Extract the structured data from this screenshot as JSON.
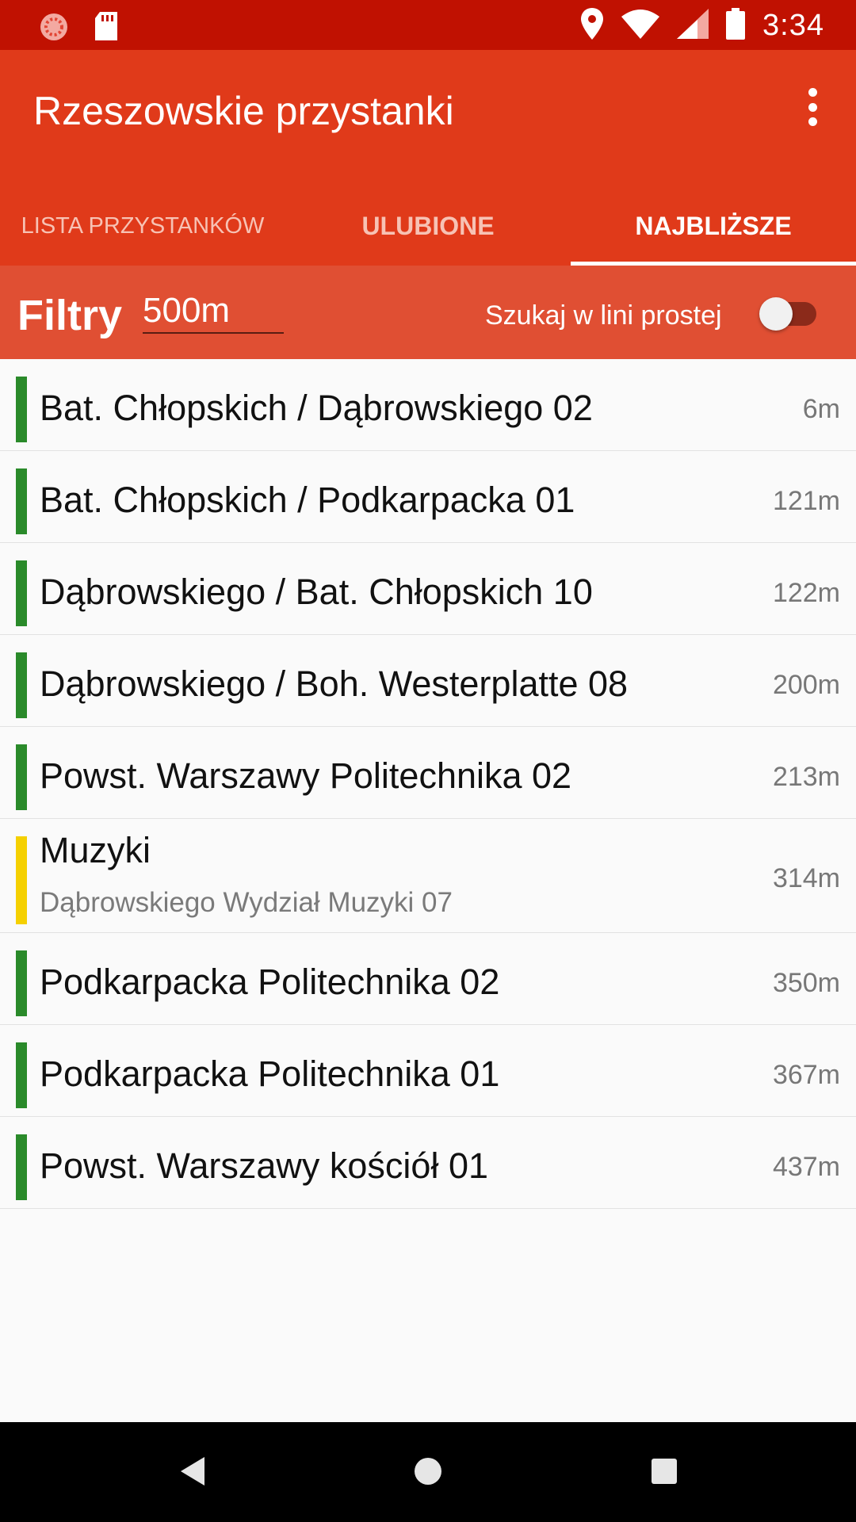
{
  "status_bar": {
    "time": "3:34",
    "icons_left": [
      "circle-notification-icon",
      "sd-card-icon"
    ],
    "icons_right": [
      "location-icon",
      "wifi-icon",
      "signal-icon",
      "battery-icon"
    ]
  },
  "app": {
    "title": "Rzeszowskie przystanki",
    "colors": {
      "status_bar": "#c01101",
      "app_bar": "#e03a1a",
      "filter_bar": "#e04f33"
    }
  },
  "tabs": [
    {
      "label": "LISTA PRZYSTANKÓW",
      "active": false
    },
    {
      "label": "ULUBIONE",
      "active": false
    },
    {
      "label": "NAJBLIŻSZE",
      "active": true
    }
  ],
  "filter": {
    "label": "Filtry",
    "distance_value": "500m",
    "straight_line_label": "Szukaj w lini prostej",
    "straight_line_enabled": false
  },
  "stops": [
    {
      "name": "Bat. Chłopskich / Dąbrowskiego 02",
      "subtitle": "",
      "distance": "6m",
      "color": "#2a8a2a"
    },
    {
      "name": "Bat. Chłopskich / Podkarpacka 01",
      "subtitle": "",
      "distance": "121m",
      "color": "#2a8a2a"
    },
    {
      "name": "Dąbrowskiego / Bat. Chłopskich 10",
      "subtitle": "",
      "distance": "122m",
      "color": "#2a8a2a"
    },
    {
      "name": "Dąbrowskiego / Boh. Westerplatte 08",
      "subtitle": "",
      "distance": "200m",
      "color": "#2a8a2a"
    },
    {
      "name": "Powst. Warszawy Politechnika 02",
      "subtitle": "",
      "distance": "213m",
      "color": "#2a8a2a"
    },
    {
      "name": "Muzyki",
      "subtitle": "Dąbrowskiego Wydział Muzyki 07",
      "distance": "314m",
      "color": "#f5d000"
    },
    {
      "name": "Podkarpacka Politechnika 02",
      "subtitle": "",
      "distance": "350m",
      "color": "#2a8a2a"
    },
    {
      "name": "Podkarpacka Politechnika 01",
      "subtitle": "",
      "distance": "367m",
      "color": "#2a8a2a"
    },
    {
      "name": "Powst. Warszawy kościół 01",
      "subtitle": "",
      "distance": "437m",
      "color": "#2a8a2a"
    }
  ],
  "nav_bar": {
    "buttons": [
      "back-icon",
      "home-icon",
      "recents-icon"
    ]
  }
}
